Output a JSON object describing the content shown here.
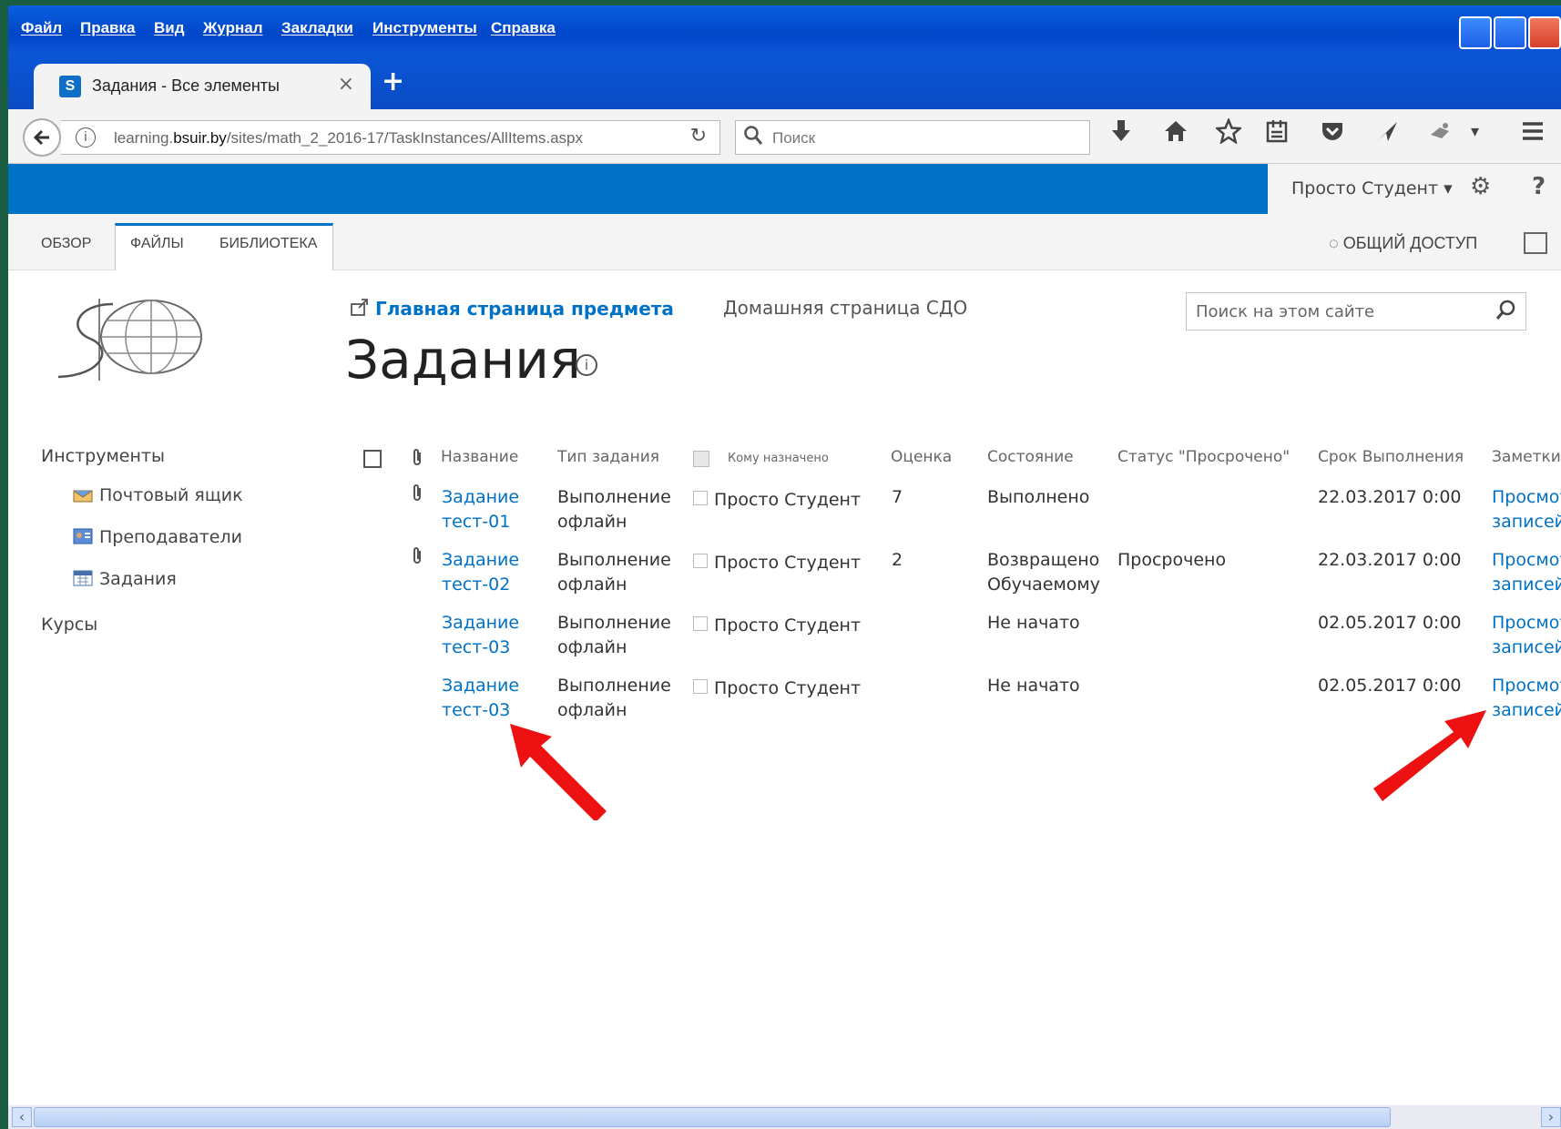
{
  "menu": [
    "Файл",
    "Правка",
    "Вид",
    "Журнал",
    "Закладки",
    "Инструменты",
    "Справка"
  ],
  "browser_tab": {
    "favicon": "S",
    "title": "Задания - Все элементы",
    "close": "×",
    "new_tab": "+"
  },
  "nav": {
    "url_prefix": "learning.",
    "url_host": "bsuir.by",
    "url_path": "/sites/math_2_2016-17/TaskInstances/AllItems.aspx",
    "search_placeholder": "Поиск"
  },
  "suite": {
    "user": "Просто Студент ▾",
    "help": "?"
  },
  "ribbon": {
    "tabs": [
      "ОБЗОР",
      "ФАЙЛЫ",
      "БИБЛИОТЕКА"
    ],
    "share": "ОБЩИЙ ДОСТУП"
  },
  "header": {
    "home_link": "Главная страница предмета",
    "sdo_link": "Домашняя страница СДО",
    "title": "Задания",
    "site_search_placeholder": "Поиск на этом сайте"
  },
  "leftnav": {
    "tools_heading": "Инструменты",
    "items": [
      "Почтовый ящик",
      "Преподаватели",
      "Задания"
    ],
    "courses_heading": "Курсы"
  },
  "table": {
    "headers": {
      "name": "Название",
      "type": "Тип задания",
      "assigned": "Кому назначено",
      "grade": "Оценка",
      "state": "Состояние",
      "overdue": "Статус \"Просрочено\"",
      "due": "Срок Выполнения",
      "notes": "Заметки"
    },
    "rows": [
      {
        "name1": "Задание",
        "name2": "тест-01",
        "type1": "Выполнение",
        "type2": "офлайн",
        "assigned": "Просто Студент",
        "grade": "7",
        "state1": "Выполнено",
        "state2": "",
        "overdue": "",
        "due": "22.03.2017 0:00",
        "notes1": "Просмот",
        "notes2": "записей"
      },
      {
        "name1": "Задание",
        "name2": "тест-02",
        "type1": "Выполнение",
        "type2": "офлайн",
        "assigned": "Просто Студент",
        "grade": "2",
        "state1": "Возвращено",
        "state2": "Обучаемому",
        "overdue": "Просрочено",
        "due": "22.03.2017 0:00",
        "notes1": "Просмот",
        "notes2": "записей"
      },
      {
        "name1": "Задание",
        "name2": "тест-03",
        "type1": "Выполнение",
        "type2": "офлайн",
        "assigned": "Просто Студент",
        "grade": "",
        "state1": "Не начато",
        "state2": "",
        "overdue": "",
        "due": "02.05.2017 0:00",
        "notes1": "Просмот",
        "notes2": "записей"
      },
      {
        "name1": "Задание",
        "name2": "тест-03",
        "type1": "Выполнение",
        "type2": "офлайн",
        "assigned": "Просто Студент",
        "grade": "",
        "state1": "Не начато",
        "state2": "",
        "overdue": "",
        "due": "02.05.2017 0:00",
        "notes1": "Просмот",
        "notes2": "записей"
      }
    ]
  },
  "colors": {
    "suite_blue": "#0072c6",
    "link": "#0072c6",
    "arrow": "#ee1111"
  }
}
